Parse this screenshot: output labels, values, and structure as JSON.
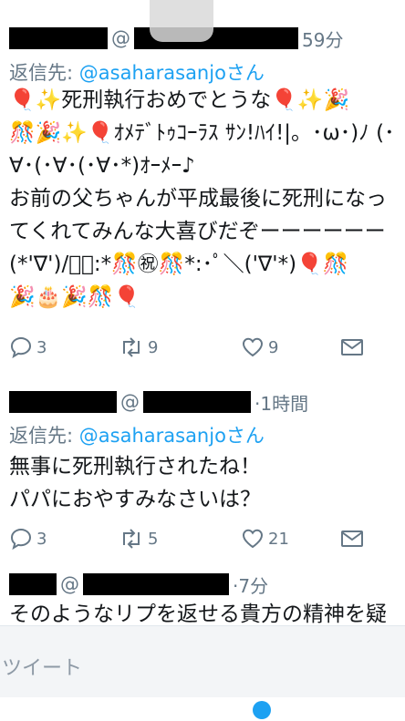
{
  "tweets": [
    {
      "at_symbol": "@",
      "time": "59分",
      "reply_label": "返信先: ",
      "reply_handle": "@asaharasanjoさん",
      "lines": [
        "🎈✨死刑執行おめでとうな🎈✨🎉",
        "🎊🎉✨🎈ｵﾒﾃﾞﾄｩｺｰﾗｽ ｻﾝ!ﾊｲ!|。･ω･)ﾉ (･",
        "∀･(･∀･(･∀･*)ｵｰﾒｰ♪",
        "お前の父ちゃんが平成最後に死刑になっ",
        "てくれてみんな大喜びだぞーーーーーー",
        "(*'∇')/ﾟ･:*🎊㊗🎊*:･ﾟ＼('∇'*)🎈🎊",
        "🎉🎂🎉🎊🎈"
      ],
      "replies": "3",
      "retweets": "9",
      "likes": "9"
    },
    {
      "at_symbol": "@",
      "time": "·1時間",
      "reply_label": "返信先: ",
      "reply_handle": "@asaharasanjoさん",
      "lines": [
        "無事に死刑執行されたね！",
        "パパにおやすみなさいは？"
      ],
      "replies": "3",
      "retweets": "5",
      "likes": "21"
    },
    {
      "at_symbol": "@",
      "time": "·7分",
      "lines": [
        "そのようなリプを返せる貴方の精神を疑"
      ]
    }
  ],
  "compose": {
    "placeholder": "ツイート"
  },
  "icons": {
    "reply": "reply-icon",
    "retweet": "retweet-icon",
    "like": "heart-icon",
    "message": "envelope-icon"
  },
  "colors": {
    "link": "#1da1f2",
    "muted": "#657786",
    "text": "#14171a"
  }
}
